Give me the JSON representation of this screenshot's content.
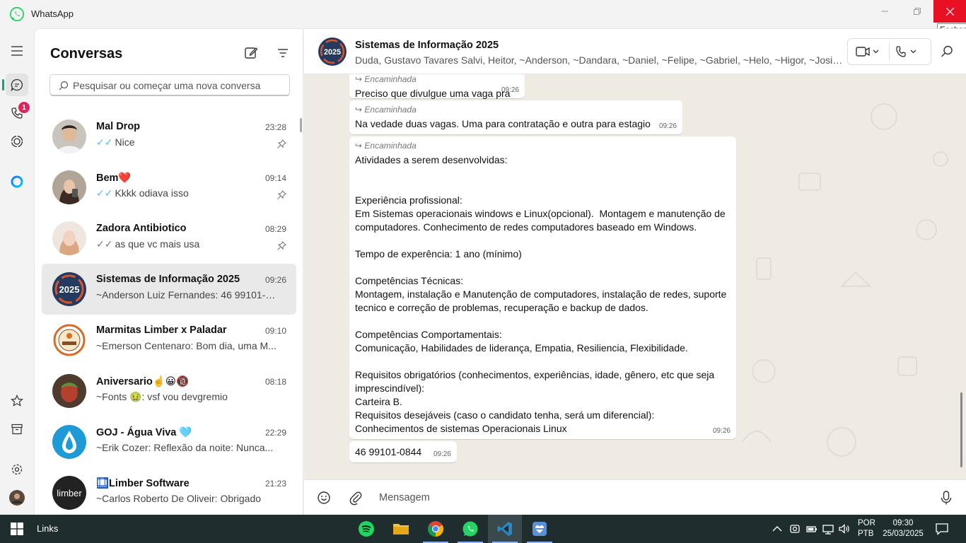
{
  "window": {
    "app_title": "WhatsApp",
    "close_tooltip": "Fechar"
  },
  "rail": {
    "calls_badge": "1"
  },
  "chat_list": {
    "title": "Conversas",
    "search_placeholder": "Pesquisar ou começar uma nova conversa",
    "chats": [
      {
        "name": "Mal Drop",
        "time": "23:28",
        "preview": "Nice",
        "tick": "✓✓",
        "pinned": true
      },
      {
        "name": "Bem❤️",
        "time": "09:14",
        "preview": "Kkkk odiava isso",
        "tick": "✓✓",
        "pinned": true
      },
      {
        "name": "Zadora Antibiotico",
        "time": "08:29",
        "preview": "as que vc mais usa",
        "tick": "✓✓",
        "pinned": true
      },
      {
        "name": "Sistemas de Informação 2025",
        "time": "09:26",
        "preview": "~Anderson Luiz Fernandes: 46 99101-0...",
        "selected": true
      },
      {
        "name": "Marmitas Limber x Paladar",
        "time": "09:10",
        "preview": "~Emerson Centenaro: Bom dia, uma M..."
      },
      {
        "name": "Aniversario☝️😀🔞",
        "time": "08:18",
        "preview": "~Fonts 🤢: vsf vou devgremio"
      },
      {
        "name": "GOJ - Água Viva 🩵",
        "time": "22:29",
        "preview": "~Erik Cozer: Reflexão da noite:  Nunca..."
      },
      {
        "name": "🛄Limber Software",
        "time": "21:23",
        "preview": "~Carlos Roberto De Oliveir: Obrigado"
      }
    ]
  },
  "conversation": {
    "name": "Sistemas de Informação 2025",
    "members": "Duda, Gustavo Tavares Salvi, Heitor, ~Anderson, ~Dandara, ~Daniel, ~Felipe, ~Gabriel, ~Helo, ~Higor, ~Josimar",
    "avatar_text": "2025",
    "messages": [
      {
        "forwarded": "Encaminhada",
        "text": "Preciso que divulgue uma vaga pra mim:",
        "time": "09:26"
      },
      {
        "forwarded": "Encaminhada",
        "text": "Na vedade duas vagas. Uma para contratação e outra para estagio",
        "time": "09:26"
      },
      {
        "forwarded": "Encaminhada",
        "text": "Atividades a serem desenvolvidas:\n\n\nExperiência profissional:\nEm Sistemas operacionais windows e Linux(opcional).  Montagem e manutenção de computadores. Conhecimento de redes computadores baseado em Windows.\n\nTempo de experência: 1 ano (mínimo)\n\nCompetências Técnicas:\nMontagem, instalação e Manutenção de computadores, instalação de redes, suporte tecnico e correção de problemas, recuperação e backup de dados.\n\nCompetências Comportamentais:\nComunicação, Habilidades de liderança, Empatia, Resiliencia, Flexibilidade.\n\nRequisitos obrigatórios (conhecimentos, experiências, idade, gênero, etc que seja imprescindível):\nCarteira B.\nRequisitos desejáveis (caso o candidato tenha, será um diferencial):\nConhecimentos de sistemas Operacionais Linux",
        "time": "09:26"
      },
      {
        "text": "46 99101-0844",
        "time": "09:26"
      }
    ]
  },
  "composer": {
    "placeholder": "Mensagem"
  },
  "taskbar": {
    "links_label": "Links",
    "lang_line1": "POR",
    "lang_line2": "PTB",
    "time": "09:30",
    "date": "25/03/2025"
  },
  "colors": {
    "accent": "#00a884",
    "read_tick": "#53bdeb",
    "close_red": "#e81123",
    "chat_bg": "#efeae2",
    "taskbar": "#1f2d2f"
  }
}
